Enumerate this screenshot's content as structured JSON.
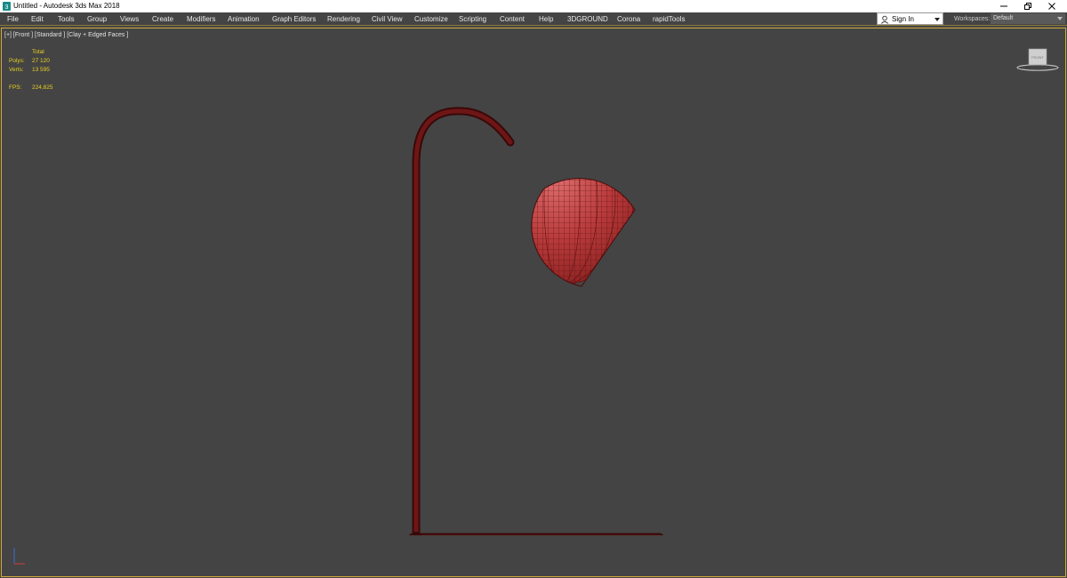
{
  "window": {
    "title": "Untitled - Autodesk 3ds Max 2018",
    "app_icon": "3ds-max-icon",
    "controls": [
      "minimize-icon",
      "restore-icon",
      "close-icon"
    ]
  },
  "menu": {
    "items": [
      "File",
      "Edit",
      "Tools",
      "Group",
      "Views",
      "Create",
      "Modifiers",
      "Animation",
      "Graph Editors",
      "Rendering",
      "Civil View",
      "Customize",
      "Scripting",
      "Content",
      "Help",
      "3DGROUND",
      "Corona",
      "rapidTools"
    ]
  },
  "account": {
    "signin_label": "Sign In",
    "workspaces_label": "Workspaces:",
    "workspace_value": "Default"
  },
  "viewport": {
    "label": "[+] [Front ] [Standard ] [Clay + Edged Faces ]",
    "stats": {
      "total_label": "Total",
      "polys_label": "Polys:",
      "polys_value": "27 120",
      "verts_label": "Verts:",
      "verts_value": "13 595",
      "fps_label": "FPS:",
      "fps_value": "224,825"
    },
    "viewcube_label": "FRONT"
  },
  "colors": {
    "viewport_bg": "#444444",
    "viewport_border": "#d2a93a",
    "stats_text": "#e8d020",
    "lamp_red": "#b33a3a",
    "wire": "#5a0f0f"
  }
}
